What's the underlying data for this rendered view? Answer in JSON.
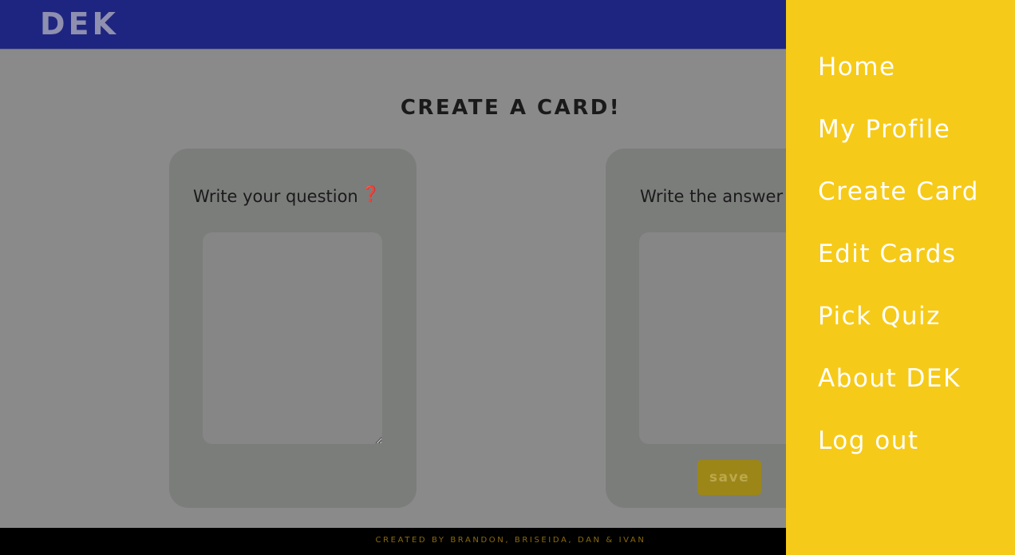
{
  "header": {
    "logo": "DEK"
  },
  "main": {
    "title": "CREATE A CARD!",
    "question_panel": {
      "label": "Write your question",
      "label_icon": "❓",
      "value": ""
    },
    "answer_panel": {
      "label": "Write the answer",
      "value": "",
      "save_label": "save"
    }
  },
  "footer": {
    "credits": "CREATED BY BRANDON, BRISEIDA, DAN & IVAN"
  },
  "menu": {
    "items": [
      {
        "label": "Home"
      },
      {
        "label": "My Profile"
      },
      {
        "label": "Create Card"
      },
      {
        "label": "Edit Cards"
      },
      {
        "label": "Pick Quiz"
      },
      {
        "label": "About DEK"
      },
      {
        "label": "Log out"
      }
    ]
  },
  "colors": {
    "header": "#1e2580",
    "menu": "#f6ca18",
    "overlay_page": "#8a8a8a",
    "footer": "#000000"
  }
}
